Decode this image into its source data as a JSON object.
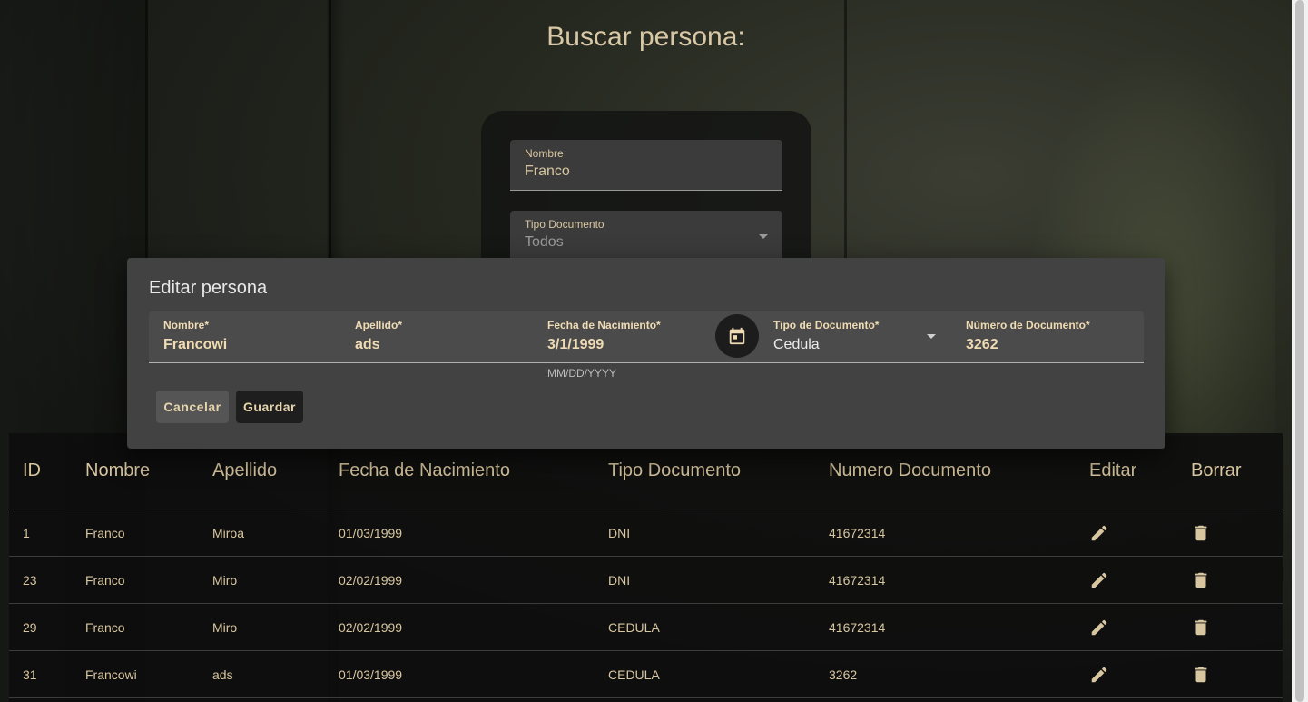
{
  "page": {
    "title": "Buscar persona:"
  },
  "search": {
    "nombre_label": "Nombre",
    "nombre_value": "Franco",
    "tipo_label": "Tipo Documento",
    "tipo_value": "Todos"
  },
  "dialog": {
    "title": "Editar persona",
    "fields": {
      "nombre": {
        "label": "Nombre*",
        "value": "Francowi"
      },
      "apellido": {
        "label": "Apellido*",
        "value": "ads"
      },
      "fecha": {
        "label": "Fecha de Nacimiento*",
        "value": "3/1/1999",
        "hint": "MM/DD/YYYY"
      },
      "tipo": {
        "label": "Tipo de Documento*",
        "value": "Cedula"
      },
      "numero": {
        "label": "Número de Documento*",
        "value": "3262"
      }
    },
    "cancel_label": "Cancelar",
    "save_label": "Guardar"
  },
  "table": {
    "headers": [
      "ID",
      "Nombre",
      "Apellido",
      "Fecha de Nacimiento",
      "Tipo Documento",
      "Numero Documento",
      "Editar",
      "Borrar"
    ],
    "rows": [
      {
        "id": "1",
        "nombre": "Franco",
        "apellido": "Miroa",
        "fecha": "01/03/1999",
        "tipo": "DNI",
        "numero": "41672314"
      },
      {
        "id": "23",
        "nombre": "Franco",
        "apellido": "Miro",
        "fecha": "02/02/1999",
        "tipo": "DNI",
        "numero": "41672314"
      },
      {
        "id": "29",
        "nombre": "Franco",
        "apellido": "Miro",
        "fecha": "02/02/1999",
        "tipo": "CEDULA",
        "numero": "41672314"
      },
      {
        "id": "31",
        "nombre": "Francowi",
        "apellido": "ads",
        "fecha": "01/03/1999",
        "tipo": "CEDULA",
        "numero": "3262"
      }
    ]
  },
  "icons": {
    "edit": "pencil-icon",
    "delete": "trash-icon",
    "calendar": "calendar-icon",
    "dropdown": "chevron-down-icon"
  },
  "colors": {
    "accent_text": "#d8c6a0",
    "dialog_bg": "#424242"
  }
}
